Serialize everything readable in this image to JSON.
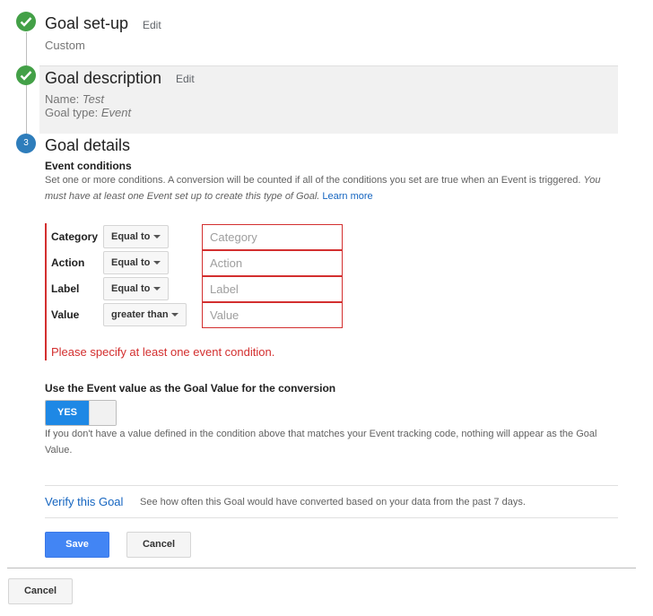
{
  "setup": {
    "title": "Goal set-up",
    "edit": "Edit",
    "value": "Custom"
  },
  "description": {
    "title": "Goal description",
    "edit": "Edit",
    "name_label": "Name:",
    "name_value": "Test",
    "type_label": "Goal type:",
    "type_value": "Event"
  },
  "details": {
    "step_number": "3",
    "title": "Goal details",
    "event_conditions_title": "Event conditions",
    "help_text": "Set one or more conditions. A conversion will be counted if all of the conditions you set are true when an Event is triggered.",
    "help_italic_1": "You",
    "help_italic_2": "must have at least one Event set up to create this type of Goal.",
    "learn_more": "Learn more",
    "conditions": [
      {
        "label": "Category",
        "operator": "Equal to",
        "placeholder": "Category"
      },
      {
        "label": "Action",
        "operator": "Equal to",
        "placeholder": "Action"
      },
      {
        "label": "Label",
        "operator": "Equal to",
        "placeholder": "Label"
      },
      {
        "label": "Value",
        "operator": "greater than",
        "placeholder": "Value"
      }
    ],
    "error": "Please specify at least one event condition.",
    "use_value_title": "Use the Event value as the Goal Value for the conversion",
    "toggle_label": "YES",
    "toggle_help_1": "If you don't have a value defined in the condition above that matches your Event tracking code, nothing will appear as the Goal",
    "toggle_help_2": "Value.",
    "verify_link": "Verify this Goal",
    "verify_text": "See how often this Goal would have converted based on your data from the past 7 days.",
    "save": "Save",
    "cancel": "Cancel"
  },
  "footer": {
    "cancel": "Cancel"
  },
  "colors": {
    "check": "#43a047",
    "step": "#2e7dbb",
    "error": "#d32f2f",
    "primary": "#4285f4",
    "link": "#1565c0"
  },
  "icons": [
    "checkmark-icon",
    "checkmark-icon",
    "chevron-down-icon"
  ]
}
